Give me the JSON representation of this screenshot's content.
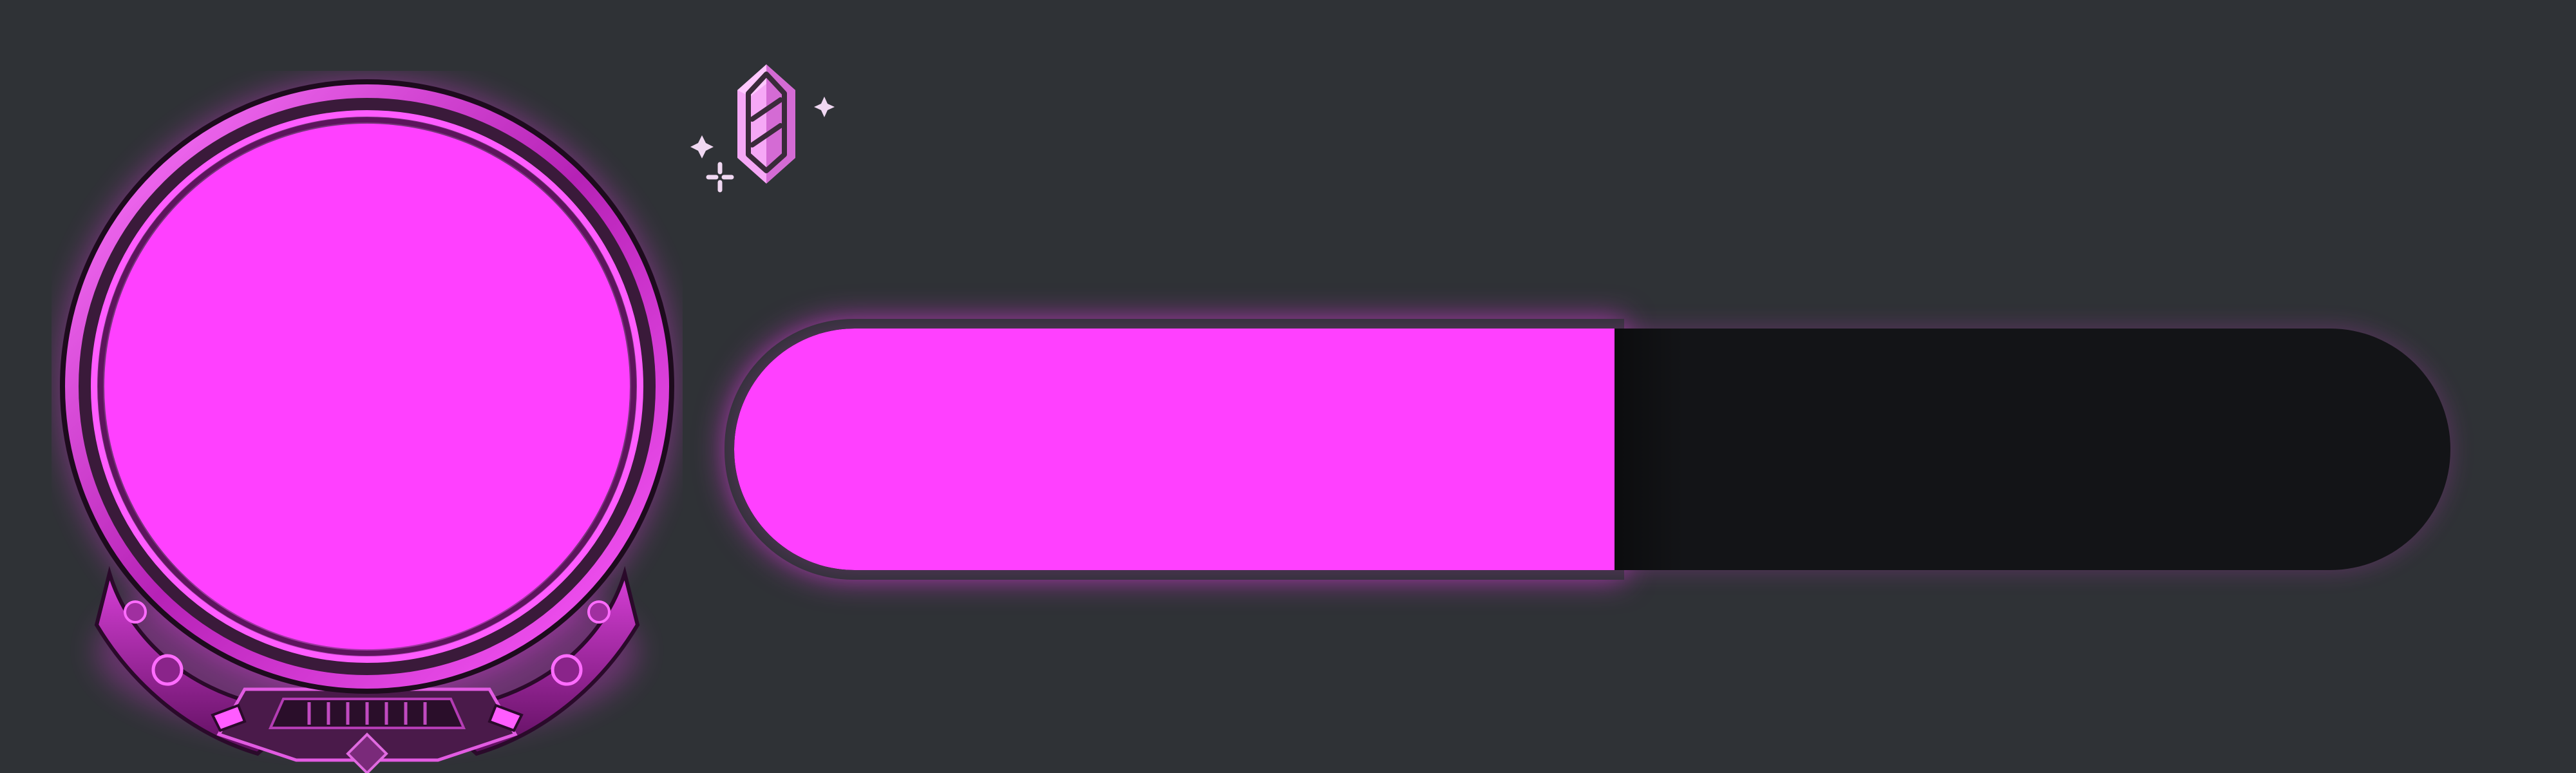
{
  "theme": {
    "background": "#2f3236",
    "accent": "#ff40ff",
    "accent_dark": "#9b1c9b",
    "track": "#131417",
    "gem_light": "#f6a8f6",
    "gem_mid": "#d46bd4",
    "sparkle": "#f0d8f2"
  },
  "avatar": {
    "icon": "circular-avatar-frame",
    "fill": "#ff40ff"
  },
  "level_badge": {
    "icon": "crystal-gem-icon"
  },
  "progress": {
    "fraction": 0.513
  }
}
